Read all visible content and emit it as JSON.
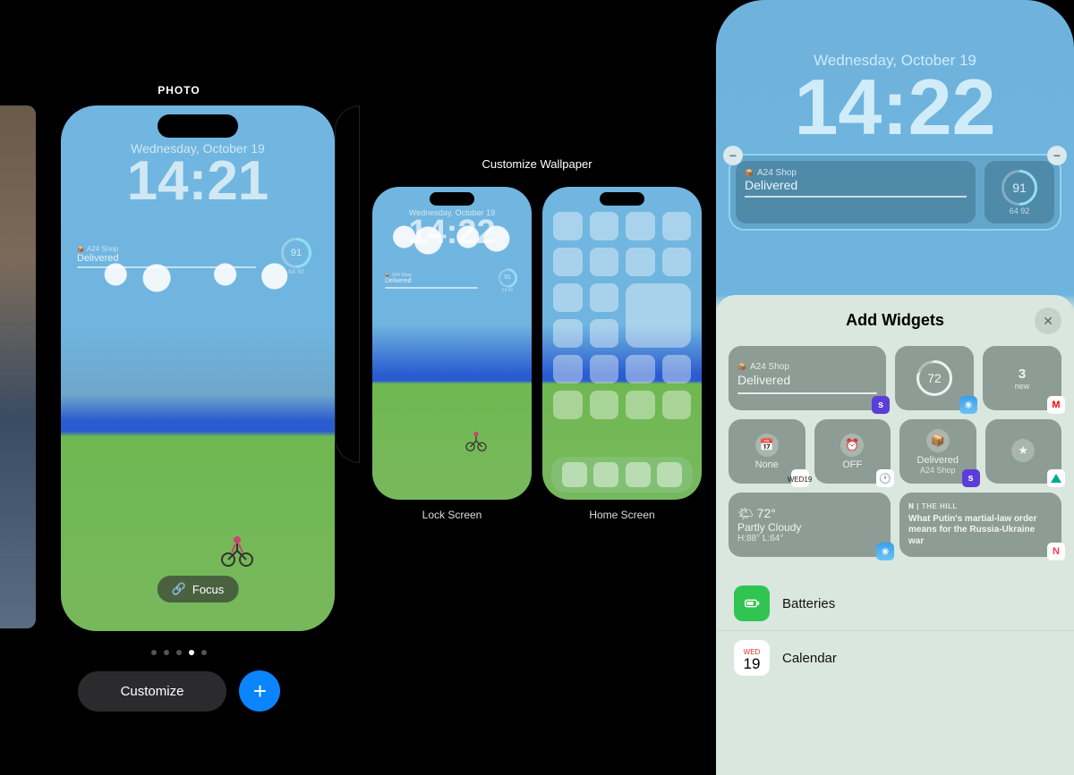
{
  "panel1": {
    "title": "PHOTO",
    "date": "Wednesday, October 19",
    "time": "14:21",
    "widget_delivery": {
      "shop": "A24 Shop",
      "status": "Delivered"
    },
    "widget_battery": {
      "value": "91",
      "sub": "64  92"
    },
    "focus_label": "Focus",
    "customize_label": "Customize",
    "page_index": 3,
    "page_count": 5
  },
  "panel2": {
    "title": "Customize Wallpaper",
    "lock_label": "Lock Screen",
    "home_label": "Home Screen",
    "date": "Wednesday, October 19",
    "time": "14:22",
    "widget_delivery": {
      "shop": "A24 Shop",
      "status": "Delivered"
    },
    "widget_battery": {
      "value": "91",
      "sub": "64  92"
    }
  },
  "panel3": {
    "date": "Wednesday, October 19",
    "time": "14:22",
    "widget_delivery": {
      "shop": "A24 Shop",
      "status": "Delivered"
    },
    "widget_battery": {
      "value": "91",
      "sub": "64  92"
    },
    "sheet": {
      "title": "Add Widgets",
      "suggestions": {
        "delivery": {
          "shop": "A24 Shop",
          "status": "Delivered"
        },
        "weather_ring": {
          "value": "72"
        },
        "mail": {
          "count": "3",
          "label": "new"
        },
        "cal": {
          "label": "None",
          "badge_day": "WED",
          "badge_num": "19"
        },
        "clock": {
          "label": "OFF"
        },
        "shop2": {
          "line1": "Delivered",
          "line2": "A24 Shop"
        },
        "drive": {},
        "weather_wide": {
          "temp": "72°",
          "cond": "Partly Cloudy",
          "hl": "H:88° L:64°"
        },
        "news": {
          "source": "THE HILL",
          "headline": "What Putin's martial-law order means for the Russia-Ukraine war"
        }
      },
      "apps": {
        "batteries": "Batteries",
        "calendar": "Calendar",
        "cal_badge_day": "WED",
        "cal_badge_num": "19"
      }
    }
  }
}
